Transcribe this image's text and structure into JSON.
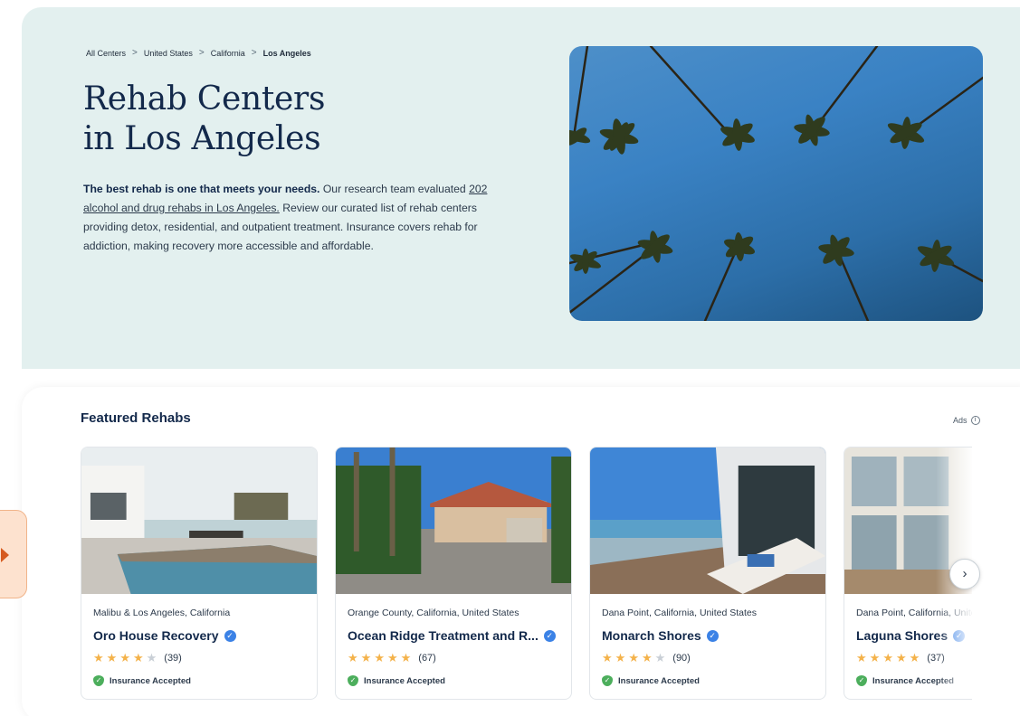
{
  "breadcrumb": {
    "items": [
      "All Centers",
      "United States",
      "California"
    ],
    "current": "Los Angeles",
    "separator": ">"
  },
  "hero": {
    "title_line1": "Rehab Centers",
    "title_line2": "in Los Angeles",
    "desc_bold": "The best rehab is one that meets your needs.",
    "desc_text1": " Our research team evaluated ",
    "desc_link": "202 alcohol and drug rehabs in Los Angeles.",
    "desc_text2": " Review our curated list of rehab centers providing detox, residential, and outpatient treatment. Insurance covers rehab for addiction, making recovery more accessible and affordable."
  },
  "featured": {
    "title": "Featured Rehabs",
    "ads_label": "Ads",
    "ads_icon": "info-icon",
    "next_icon": "chevron-right-icon",
    "cards": [
      {
        "location": "Malibu & Los Angeles, California",
        "name": "Oro House Recovery",
        "rating": 4.5,
        "reviews": "(39)",
        "insurance": "Insurance Accepted"
      },
      {
        "location": "Orange County, California, United States",
        "name": "Ocean Ridge Treatment and R...",
        "rating": 5,
        "reviews": "(67)",
        "insurance": "Insurance Accepted"
      },
      {
        "location": "Dana Point, California, United States",
        "name": "Monarch Shores",
        "rating": 4.5,
        "reviews": "(90)",
        "insurance": "Insurance Accepted"
      },
      {
        "location": "Dana Point, California, United States",
        "name": "Laguna Shores",
        "rating": 5,
        "reviews": "(37)",
        "insurance": "Insurance Accepted"
      }
    ]
  },
  "colors": {
    "hero_bg": "#e3f0ef",
    "star": "#f4b24a",
    "verified": "#3b82e6",
    "insurance_shield": "#4cae5c",
    "side_tab": "#fde2cf",
    "side_arrow": "#d65a1f"
  }
}
